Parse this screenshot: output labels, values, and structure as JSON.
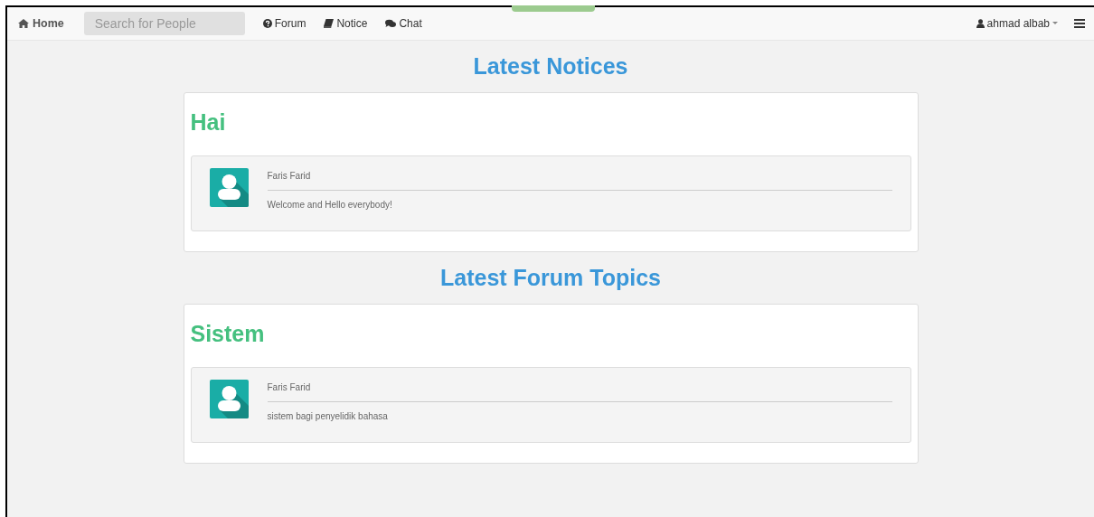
{
  "navbar": {
    "brand": "Home",
    "search": {
      "placeholder": "Search for People"
    },
    "links": [
      {
        "kind": "forum",
        "label": "Forum"
      },
      {
        "kind": "notice",
        "label": "Notice"
      },
      {
        "kind": "chat",
        "label": "Chat"
      }
    ],
    "user": "ahmad albab"
  },
  "sections": [
    {
      "heading": "Latest Notices",
      "cards": [
        {
          "title": "Hai",
          "author": "Faris Farid",
          "message": "Welcome and Hello everybody!"
        }
      ]
    },
    {
      "heading": "Latest Forum Topics",
      "cards": [
        {
          "title": "Sistem",
          "author": "Faris Farid",
          "message": "sistem bagi penyelidik bahasa"
        }
      ]
    }
  ]
}
